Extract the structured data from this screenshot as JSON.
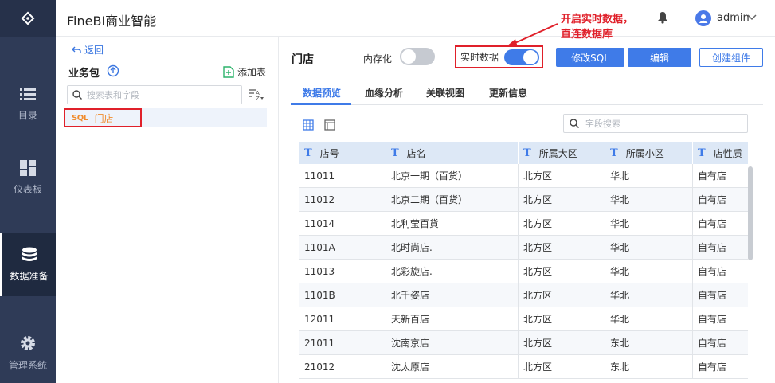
{
  "app": {
    "title": "FineBI商业智能"
  },
  "user": {
    "name": "admin"
  },
  "annotation": {
    "line1": "开启实时数据，",
    "line2": "直连数据库"
  },
  "nav": {
    "items": [
      {
        "label": "目录",
        "icon": "list-icon"
      },
      {
        "label": "仪表板",
        "icon": "dashboard-icon"
      },
      {
        "label": "数据准备",
        "icon": "database-icon",
        "active": true
      },
      {
        "label": "管理系统",
        "icon": "gear-icon"
      }
    ]
  },
  "packages": {
    "back_label": "返回",
    "title": "业务包",
    "add_label": "添加表",
    "search_placeholder": "搜索表和字段",
    "table_badge": "SQL",
    "table_name": "门店"
  },
  "main": {
    "title": "门店",
    "memory_label": "内存化",
    "memory_on": false,
    "realtime_label": "实时数据",
    "realtime_on": true,
    "buttons": {
      "edit_sql": "修改SQL",
      "edit": "编辑",
      "create_component": "创建组件"
    },
    "tabs": [
      "数据预览",
      "血缘分析",
      "关联视图",
      "更新信息"
    ],
    "field_search_placeholder": "字段搜索"
  },
  "grid": {
    "type_marker": "T",
    "columns": [
      "店号",
      "店名",
      "所属大区",
      "所属小区",
      "店性质"
    ],
    "rows": [
      [
        "11011",
        "北京一期（百货）",
        "北方区",
        "华北",
        "自有店"
      ],
      [
        "11012",
        "北京二期（百货）",
        "北方区",
        "华北",
        "自有店"
      ],
      [
        "11014",
        "北利莹百貨",
        "北方区",
        "华北",
        "自有店"
      ],
      [
        "1101A",
        "北时尚店.",
        "北方区",
        "华北",
        "自有店"
      ],
      [
        "11013",
        "北彩旋店.",
        "北方区",
        "华北",
        "自有店"
      ],
      [
        "1101B",
        "北千姿店",
        "北方区",
        "华北",
        "自有店"
      ],
      [
        "12011",
        "天新百店",
        "北方区",
        "华北",
        "自有店"
      ],
      [
        "21011",
        "沈南京店",
        "北方区",
        "东北",
        "自有店"
      ],
      [
        "21012",
        "沈太原店",
        "北方区",
        "东北",
        "自有店"
      ]
    ]
  },
  "colors": {
    "accent": "#3f7be8",
    "annotation": "#e0202a",
    "nav_bg": "#2f3b57"
  }
}
